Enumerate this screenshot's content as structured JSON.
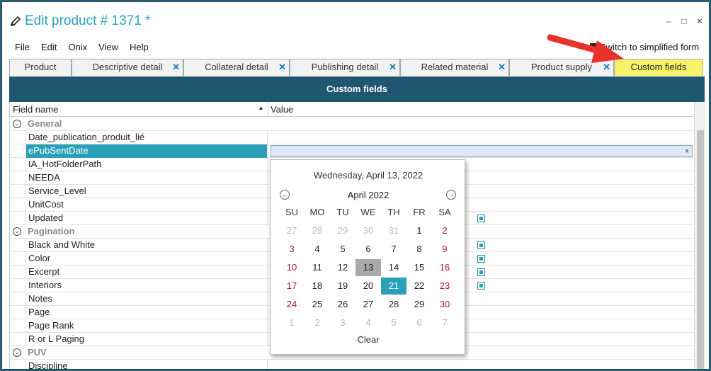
{
  "window": {
    "title": "Edit product # 1371 *",
    "controls": [
      "–",
      "□",
      "✕"
    ]
  },
  "menu": [
    "File",
    "Edit",
    "Onix",
    "View",
    "Help"
  ],
  "simplified_label": "Switch to simplified form",
  "tabs": [
    {
      "label": "Product",
      "closable": false
    },
    {
      "label": "Descriptive detail",
      "closable": true
    },
    {
      "label": "Collateral detail",
      "closable": true
    },
    {
      "label": "Publishing detail",
      "closable": true
    },
    {
      "label": "Related material",
      "closable": true
    },
    {
      "label": "Product supply",
      "closable": true
    },
    {
      "label": "Custom fields",
      "closable": false,
      "active": true
    }
  ],
  "panel_title": "Custom fields",
  "columns": {
    "field": "Field name",
    "value": "Value"
  },
  "rows": [
    {
      "type": "group",
      "name": "General"
    },
    {
      "type": "field",
      "name": "Date_publication_produit_lié"
    },
    {
      "type": "field",
      "name": "ePubSentDate",
      "selected": true
    },
    {
      "type": "field",
      "name": "IA_HotFolderPath"
    },
    {
      "type": "field",
      "name": "NEEDA"
    },
    {
      "type": "field",
      "name": "Service_Level"
    },
    {
      "type": "field",
      "name": "UnitCost"
    },
    {
      "type": "field",
      "name": "Updated",
      "checkbox": true
    },
    {
      "type": "group",
      "name": "Pagination"
    },
    {
      "type": "field",
      "name": "Black and White",
      "checkbox": true
    },
    {
      "type": "field",
      "name": "Color",
      "checkbox": true
    },
    {
      "type": "field",
      "name": "Excerpt",
      "checkbox": true
    },
    {
      "type": "field",
      "name": "Interiors",
      "checkbox": true
    },
    {
      "type": "field",
      "name": "Notes"
    },
    {
      "type": "field",
      "name": "Page"
    },
    {
      "type": "field",
      "name": "Page Rank"
    },
    {
      "type": "field",
      "name": "R or L Paging"
    },
    {
      "type": "group",
      "name": "PUV"
    },
    {
      "type": "field",
      "name": "Discipline"
    }
  ],
  "calendar": {
    "today_label": "Wednesday, April 13, 2022",
    "month_label": "April 2022",
    "weekdays": [
      "SU",
      "MO",
      "TU",
      "WE",
      "TH",
      "FR",
      "SA"
    ],
    "weeks": [
      [
        {
          "d": "27",
          "o": true
        },
        {
          "d": "28",
          "o": true
        },
        {
          "d": "29",
          "o": true
        },
        {
          "d": "30",
          "o": true
        },
        {
          "d": "31",
          "o": true
        },
        {
          "d": "1"
        },
        {
          "d": "2"
        }
      ],
      [
        {
          "d": "3"
        },
        {
          "d": "4"
        },
        {
          "d": "5"
        },
        {
          "d": "6"
        },
        {
          "d": "7"
        },
        {
          "d": "8"
        },
        {
          "d": "9"
        }
      ],
      [
        {
          "d": "10"
        },
        {
          "d": "11"
        },
        {
          "d": "12"
        },
        {
          "d": "13",
          "today": true
        },
        {
          "d": "14"
        },
        {
          "d": "15"
        },
        {
          "d": "16"
        }
      ],
      [
        {
          "d": "17"
        },
        {
          "d": "18"
        },
        {
          "d": "19"
        },
        {
          "d": "20"
        },
        {
          "d": "21",
          "selected": true
        },
        {
          "d": "22"
        },
        {
          "d": "23"
        }
      ],
      [
        {
          "d": "24"
        },
        {
          "d": "25"
        },
        {
          "d": "26"
        },
        {
          "d": "27"
        },
        {
          "d": "28"
        },
        {
          "d": "29"
        },
        {
          "d": "30"
        }
      ],
      [
        {
          "d": "1",
          "o": true
        },
        {
          "d": "2",
          "o": true
        },
        {
          "d": "3",
          "o": true
        },
        {
          "d": "4",
          "o": true
        },
        {
          "d": "5",
          "o": true
        },
        {
          "d": "6",
          "o": true
        },
        {
          "d": "7",
          "o": true
        }
      ]
    ],
    "clear_label": "Clear"
  },
  "colors": {
    "accent": "#2aa0b8",
    "header_bg": "#1f5770",
    "active_tab": "#f6f36a",
    "weekend_red": "#b0182a",
    "arrow_red": "#e8322b"
  }
}
